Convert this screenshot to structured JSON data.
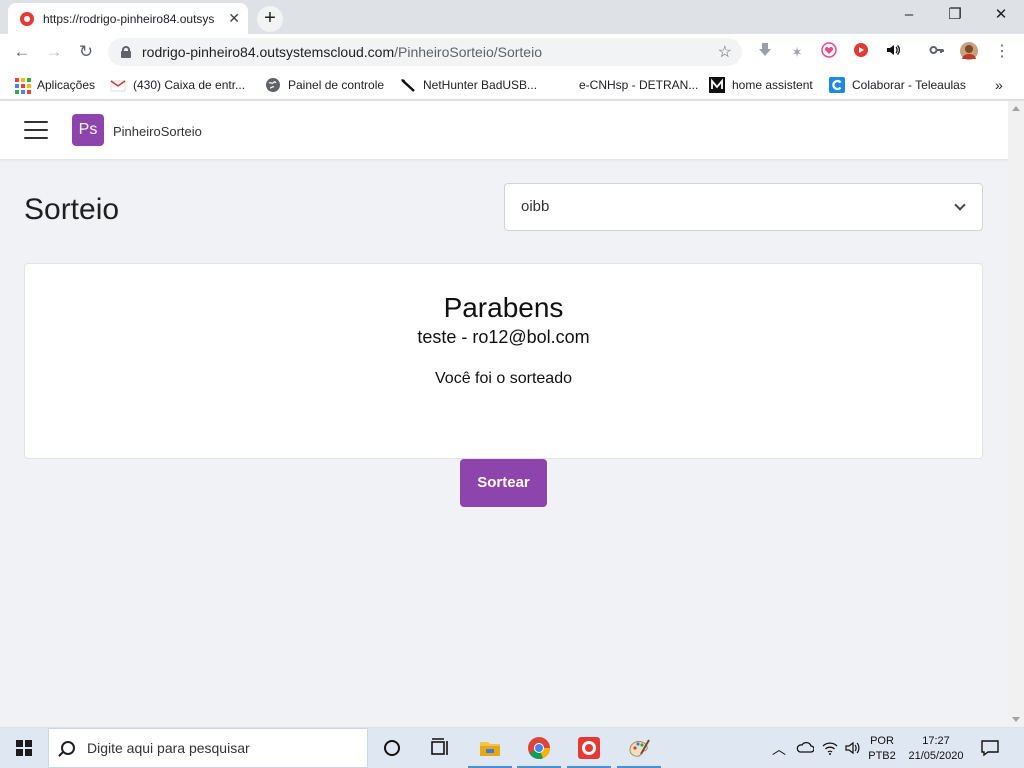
{
  "browser": {
    "tab_title": "https://rodrigo-pinheiro84.outsys",
    "tab_close": "✕",
    "new_tab": "+",
    "url_host": "rodrigo-pinheiro84.outsystemscloud.com",
    "url_path": "/PinheiroSorteio/Sorteio",
    "window_controls": [
      "–",
      "❐",
      "✕"
    ],
    "nav": {
      "back": "←",
      "forward": "→",
      "reload": "↻",
      "star": "☆",
      "menu": "⋮"
    }
  },
  "bookmarks": [
    {
      "label": "Aplicações",
      "icon": "apps-grid-icon"
    },
    {
      "label": "(430) Caixa de entr...",
      "icon": "mail-icon"
    },
    {
      "label": "Painel de controle",
      "icon": "globe-icon"
    },
    {
      "label": "NetHunter BadUSB...",
      "icon": "usb-icon"
    },
    {
      "label": "e-CNHsp - DETRAN...",
      "icon": "blank-icon"
    },
    {
      "label": "home assistent",
      "icon": "medium-icon"
    },
    {
      "label": "Colaborar - Teleaulas",
      "icon": "colaborar-icon"
    }
  ],
  "bookmarks_overflow": "»",
  "app": {
    "logo_text": "Ps",
    "name": "PinheiroSorteio",
    "page_title": "Sorteio",
    "dropdown_value": "oibb",
    "card": {
      "heading": "Parabens",
      "winner": "teste - ro12@bol.com",
      "message": "Você foi o sorteado"
    },
    "button_label": "Sortear",
    "accent_color": "#8e44ad"
  },
  "taskbar": {
    "search_placeholder": "Digite aqui para pesquisar",
    "language_top": "POR",
    "language_bottom": "PTB2",
    "time": "17:27",
    "date": "21/05/2020"
  }
}
